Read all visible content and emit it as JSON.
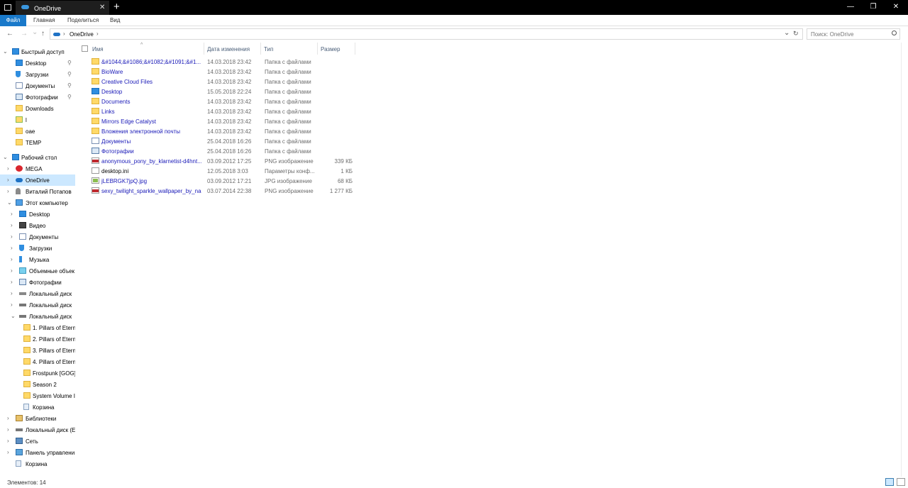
{
  "window": {
    "tab_title": "OneDrive",
    "new_tab": "+",
    "close_tab": "✕",
    "minimize": "—",
    "maximize": "❐",
    "close": "✕"
  },
  "ribbon": {
    "tabs": [
      "Файл",
      "Главная",
      "Поделиться",
      "Вид"
    ]
  },
  "address": {
    "back": "←",
    "forward": "→",
    "recent": "⌄",
    "up": "↑",
    "sep": "›",
    "crumb": "OneDrive",
    "crumb_sep": "›",
    "dropdown": "⌄",
    "refresh": "↻",
    "search_placeholder": "Поиск: OneDrive"
  },
  "sidebar": {
    "quick_access": {
      "label": "Быстрый доступ",
      "items": [
        {
          "label": "Desktop",
          "pinned": true,
          "icon": "desktop-folder"
        },
        {
          "label": "Загрузки",
          "pinned": true,
          "icon": "downloads-arrow"
        },
        {
          "label": "Документы",
          "pinned": true,
          "icon": "documents-folder"
        },
        {
          "label": "Фотографии",
          "pinned": true,
          "icon": "pictures-folder"
        },
        {
          "label": "Downloads",
          "pinned": false,
          "icon": "folder"
        },
        {
          "label": "l",
          "pinned": false,
          "icon": "folder-image"
        },
        {
          "label": "oae",
          "pinned": false,
          "icon": "folder"
        },
        {
          "label": "TEMP",
          "pinned": false,
          "icon": "folder"
        }
      ]
    },
    "desktop": {
      "label": "Рабочий стол",
      "items": [
        {
          "label": "MEGA",
          "icon": "mega"
        },
        {
          "label": "OneDrive",
          "icon": "onedrive-cloud",
          "selected": true
        },
        {
          "label": "Виталий Потапов",
          "icon": "user"
        },
        {
          "label": "Этот компьютер",
          "icon": "computer"
        }
      ]
    },
    "this_pc": {
      "items": [
        {
          "label": "Desktop",
          "icon": "desktop-folder"
        },
        {
          "label": "Видео",
          "icon": "video-folder"
        },
        {
          "label": "Документы",
          "icon": "documents-folder"
        },
        {
          "label": "Загрузки",
          "icon": "downloads-arrow"
        },
        {
          "label": "Музыка",
          "icon": "music-note"
        },
        {
          "label": "Объемные объек",
          "icon": "3d-objects"
        },
        {
          "label": "Фотографии",
          "icon": "pictures-folder"
        },
        {
          "label": "Локальный диск",
          "icon": "drive-windows"
        },
        {
          "label": "Локальный диск",
          "icon": "drive"
        },
        {
          "label": "Локальный диск",
          "icon": "drive",
          "expanded": true
        }
      ]
    },
    "drive_children": [
      {
        "label": "1. Pillars of Etern"
      },
      {
        "label": "2. Pillars of Etern"
      },
      {
        "label": "3. Pillars of Etern"
      },
      {
        "label": "4. Pillars of Etern"
      },
      {
        "label": "Frostpunk [GOG]"
      },
      {
        "label": "Season 2"
      },
      {
        "label": "System Volume I"
      },
      {
        "label": "Корзина"
      }
    ],
    "bottom": [
      {
        "label": "Библиотеки",
        "icon": "libraries"
      },
      {
        "label": "Локальный диск (E",
        "icon": "drive"
      },
      {
        "label": "Сеть",
        "icon": "network"
      },
      {
        "label": "Панель управлени",
        "icon": "control-panel"
      },
      {
        "label": "Корзина",
        "icon": "recycle-bin"
      }
    ]
  },
  "columns": {
    "name": "Имя",
    "date": "Дата изменения",
    "type": "Тип",
    "size": "Размер",
    "sort_caret": "^"
  },
  "files": [
    {
      "name": "&#1044;&#1086;&#1082;&#1091;&#1...",
      "date": "14.03.2018 23:42",
      "type": "Папка с файлами",
      "size": "",
      "icon": "folder",
      "link": true
    },
    {
      "name": "BioWare",
      "date": "14.03.2018 23:42",
      "type": "Папка с файлами",
      "size": "",
      "icon": "folder",
      "link": true
    },
    {
      "name": "Creative Cloud Files",
      "date": "14.03.2018 23:42",
      "type": "Папка с файлами",
      "size": "",
      "icon": "folder",
      "link": true
    },
    {
      "name": "Desktop",
      "date": "15.05.2018 22:24",
      "type": "Папка с файлами",
      "size": "",
      "icon": "folder-blue",
      "link": true
    },
    {
      "name": "Documents",
      "date": "14.03.2018 23:42",
      "type": "Папка с файлами",
      "size": "",
      "icon": "folder",
      "link": true
    },
    {
      "name": "Links",
      "date": "14.03.2018 23:42",
      "type": "Папка с файлами",
      "size": "",
      "icon": "folder",
      "link": true
    },
    {
      "name": "Mirrors Edge Catalyst",
      "date": "14.03.2018 23:42",
      "type": "Папка с файлами",
      "size": "",
      "icon": "folder",
      "link": true
    },
    {
      "name": "Вложения электронной почты",
      "date": "14.03.2018 23:42",
      "type": "Папка с файлами",
      "size": "",
      "icon": "folder",
      "link": true
    },
    {
      "name": "Документы",
      "date": "25.04.2018 16:26",
      "type": "Папка с файлами",
      "size": "",
      "icon": "folder-doc",
      "link": true
    },
    {
      "name": "Фотографии",
      "date": "25.04.2018 16:26",
      "type": "Папка с файлами",
      "size": "",
      "icon": "folder-photo",
      "link": true
    },
    {
      "name": "anonymous_pony_by_klarnetist-d4hnt...",
      "date": "03.09.2012 17:25",
      "type": "PNG изображение",
      "size": "339 КБ",
      "icon": "png",
      "link": true
    },
    {
      "name": "desktop.ini",
      "date": "12.05.2018 3:03",
      "type": "Параметры конф...",
      "size": "1 КБ",
      "icon": "ini",
      "link": false
    },
    {
      "name": "jLEBRGK7jpQ.jpg",
      "date": "03.09.2012 17:21",
      "type": "JPG изображение",
      "size": "68 КБ",
      "icon": "jpg",
      "link": true
    },
    {
      "name": "sexy_twilight_sparkle_wallpaper_by_na...",
      "date": "03.07.2014 22:38",
      "type": "PNG изображение",
      "size": "1 277 КБ",
      "icon": "png",
      "link": true
    }
  ],
  "status": {
    "count_text": "Элементов: 14"
  }
}
